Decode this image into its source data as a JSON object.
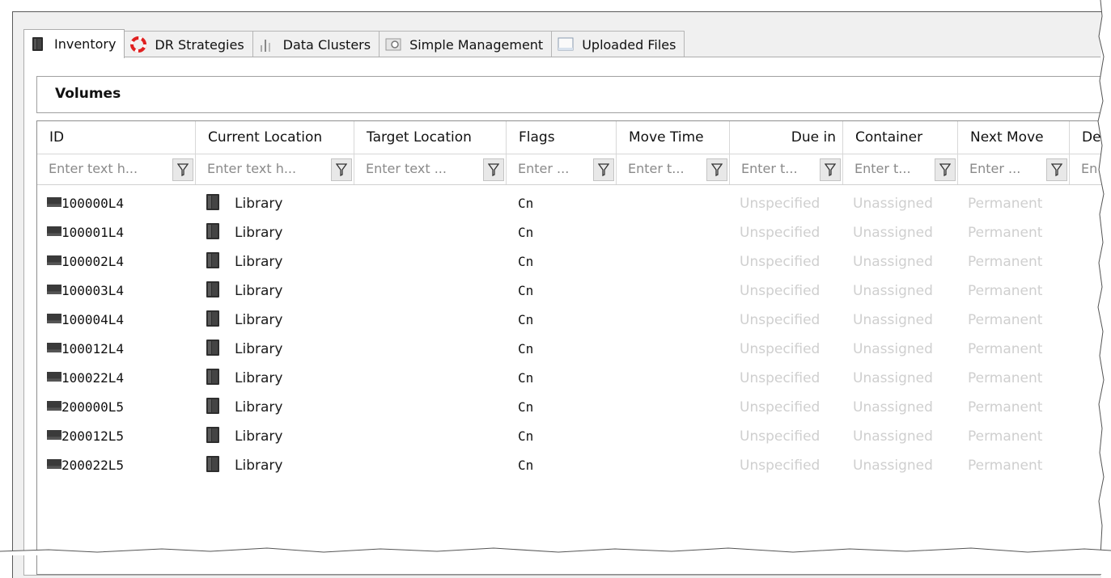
{
  "tabs": [
    {
      "label": "Inventory",
      "icon": "inventory-icon",
      "active": true
    },
    {
      "label": "DR Strategies",
      "icon": "lifebuoy-icon",
      "active": false
    },
    {
      "label": "Data Clusters",
      "icon": "clusters-icon",
      "active": false
    },
    {
      "label": "Simple Management",
      "icon": "management-icon",
      "active": false
    },
    {
      "label": "Uploaded Files",
      "icon": "files-icon",
      "active": false
    }
  ],
  "group_title": "Volumes",
  "columns": [
    {
      "label": "ID",
      "placeholder": "Enter text h...",
      "align": "left"
    },
    {
      "label": "Current Location",
      "placeholder": "Enter text h...",
      "align": "left"
    },
    {
      "label": "Target Location",
      "placeholder": "Enter text ...",
      "align": "left"
    },
    {
      "label": "Flags",
      "placeholder": "Enter ...",
      "align": "left"
    },
    {
      "label": "Move Time",
      "placeholder": "Enter t...",
      "align": "left"
    },
    {
      "label": "Due in",
      "placeholder": "Enter t...",
      "align": "right"
    },
    {
      "label": "Container",
      "placeholder": "Enter t...",
      "align": "left"
    },
    {
      "label": "Next Move",
      "placeholder": "Enter ...",
      "align": "left"
    },
    {
      "label": "De",
      "placeholder": "En",
      "align": "left"
    }
  ],
  "rows": [
    {
      "id": "100000L4",
      "current_location": "Library",
      "target_location": "",
      "flags": "Cn",
      "move_time": "",
      "due_in": "Unspecified",
      "container": "Unassigned",
      "next_move": "Permanent"
    },
    {
      "id": "100001L4",
      "current_location": "Library",
      "target_location": "",
      "flags": "Cn",
      "move_time": "",
      "due_in": "Unspecified",
      "container": "Unassigned",
      "next_move": "Permanent"
    },
    {
      "id": "100002L4",
      "current_location": "Library",
      "target_location": "",
      "flags": "Cn",
      "move_time": "",
      "due_in": "Unspecified",
      "container": "Unassigned",
      "next_move": "Permanent"
    },
    {
      "id": "100003L4",
      "current_location": "Library",
      "target_location": "",
      "flags": "Cn",
      "move_time": "",
      "due_in": "Unspecified",
      "container": "Unassigned",
      "next_move": "Permanent"
    },
    {
      "id": "100004L4",
      "current_location": "Library",
      "target_location": "",
      "flags": "Cn",
      "move_time": "",
      "due_in": "Unspecified",
      "container": "Unassigned",
      "next_move": "Permanent"
    },
    {
      "id": "100012L4",
      "current_location": "Library",
      "target_location": "",
      "flags": "Cn",
      "move_time": "",
      "due_in": "Unspecified",
      "container": "Unassigned",
      "next_move": "Permanent"
    },
    {
      "id": "100022L4",
      "current_location": "Library",
      "target_location": "",
      "flags": "Cn",
      "move_time": "",
      "due_in": "Unspecified",
      "container": "Unassigned",
      "next_move": "Permanent"
    },
    {
      "id": "200000L5",
      "current_location": "Library",
      "target_location": "",
      "flags": "Cn",
      "move_time": "",
      "due_in": "Unspecified",
      "container": "Unassigned",
      "next_move": "Permanent"
    },
    {
      "id": "200012L5",
      "current_location": "Library",
      "target_location": "",
      "flags": "Cn",
      "move_time": "",
      "due_in": "Unspecified",
      "container": "Unassigned",
      "next_move": "Permanent"
    },
    {
      "id": "200022L5",
      "current_location": "Library",
      "target_location": "",
      "flags": "Cn",
      "move_time": "",
      "due_in": "Unspecified",
      "container": "Unassigned",
      "next_move": "Permanent"
    }
  ],
  "colors": {
    "tab_active_bg": "#ffffff",
    "chrome_bg": "#f0f0f0",
    "muted_text": "#cfcfcf",
    "lifebuoy_red": "#e02020"
  }
}
